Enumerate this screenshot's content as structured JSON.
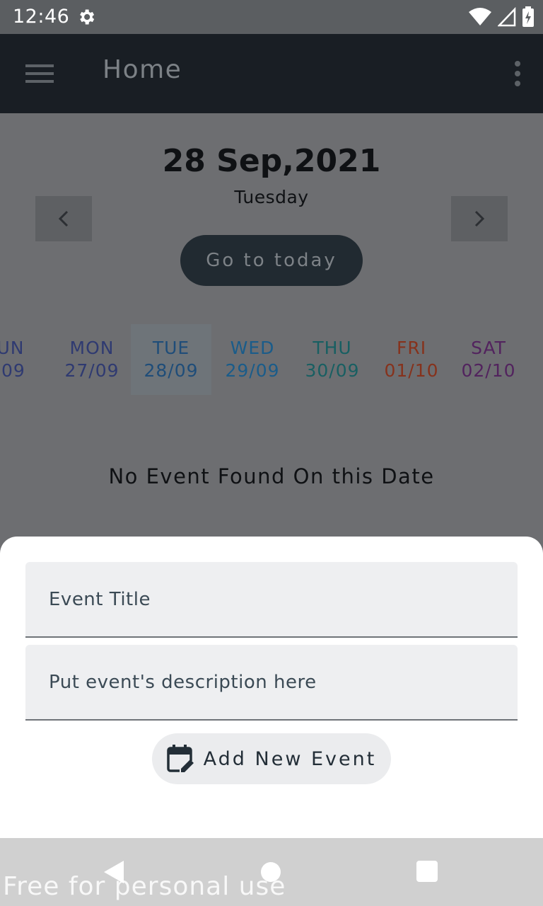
{
  "status_bar": {
    "time": "12:46"
  },
  "app_bar": {
    "title": "Home"
  },
  "date_header": {
    "date": "28 Sep,2021",
    "weekday": "Tuesday",
    "today_button": "Go to today"
  },
  "week": [
    {
      "name": "UN",
      "date": "'09"
    },
    {
      "name": "MON",
      "date": "27/09"
    },
    {
      "name": "TUE",
      "date": "28/09",
      "selected": true
    },
    {
      "name": "WED",
      "date": "29/09"
    },
    {
      "name": "THU",
      "date": "30/09"
    },
    {
      "name": "FRI",
      "date": "01/10"
    },
    {
      "name": "SAT",
      "date": "02/10"
    }
  ],
  "empty_message": "No Event Found On this Date",
  "sheet": {
    "title_placeholder": "Event Title",
    "description_placeholder": "Put event's description here",
    "add_button": "Add New Event"
  },
  "watermark": "Free for personal use",
  "colors": {
    "app_bar": "#191e24",
    "overlay": "#6d6e71",
    "sheet": "#ffffff",
    "accent_dark": "#212a31"
  }
}
